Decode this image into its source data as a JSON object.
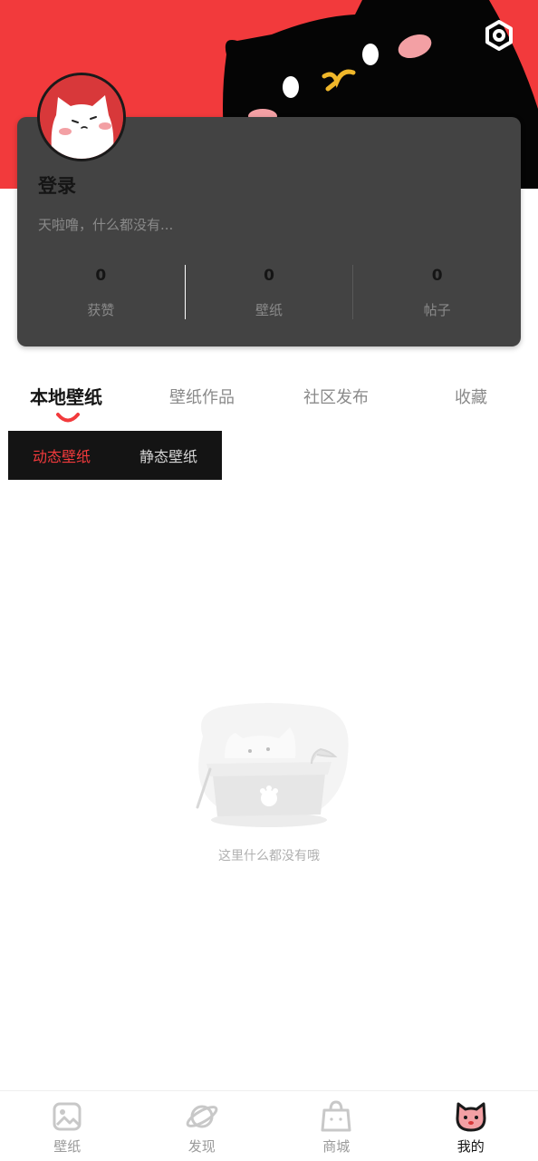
{
  "profile": {
    "login_label": "登录",
    "bio": "天啦噜，什么都没有...",
    "stats": [
      {
        "value": "0",
        "label": "获赞"
      },
      {
        "value": "0",
        "label": "壁纸"
      },
      {
        "value": "0",
        "label": "帖子"
      }
    ]
  },
  "tabs": [
    {
      "label": "本地壁纸",
      "active": true
    },
    {
      "label": "壁纸作品",
      "active": false
    },
    {
      "label": "社区发布",
      "active": false
    },
    {
      "label": "收藏",
      "active": false
    }
  ],
  "subtabs": [
    {
      "label": "动态壁纸",
      "active": true
    },
    {
      "label": "静态壁纸",
      "active": false
    }
  ],
  "empty_state": {
    "text": "这里什么都没有哦"
  },
  "bottom_nav": [
    {
      "label": "壁纸",
      "icon": "image-icon",
      "active": false
    },
    {
      "label": "发现",
      "icon": "planet-icon",
      "active": false
    },
    {
      "label": "商城",
      "icon": "shopping-bag-icon",
      "active": false
    },
    {
      "label": "我的",
      "icon": "cat-face-icon",
      "active": true
    }
  ],
  "colors": {
    "accent": "#f23a3c",
    "card_bg": "#434343",
    "subtab_bg": "#141414"
  }
}
